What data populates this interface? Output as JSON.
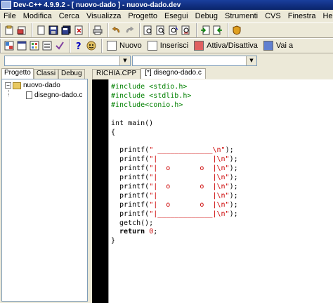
{
  "window": {
    "title": "Dev-C++ 4.9.9.2  - [ nuovo-dado ] - nuovo-dado.dev"
  },
  "menu": [
    "File",
    "Modifica",
    "Cerca",
    "Visualizza",
    "Progetto",
    "Esegui",
    "Debug",
    "Strumenti",
    "CVS",
    "Finestra",
    "Help"
  ],
  "toolbar2": {
    "new_label": "Nuovo",
    "insert_label": "Inserisci",
    "toggle_label": "Attiva/Disattiva",
    "goto_label": "Vai a"
  },
  "left_tabs": [
    "Progetto",
    "Classi",
    "Debug"
  ],
  "tree": {
    "project": "nuovo-dado",
    "file": "disegno-dado.c"
  },
  "editor_tabs": [
    "RICHIA.CPP",
    "[*] disegno-dado.c"
  ],
  "code": [
    {
      "t": "pre",
      "v": "#include <stdio.h>"
    },
    {
      "t": "pre",
      "v": "#include <stdlib.h>"
    },
    {
      "t": "pre",
      "v": "#include<conio.h>"
    },
    {
      "t": "plain",
      "v": ""
    },
    {
      "t": "plain",
      "v": "int main()"
    },
    {
      "t": "plain",
      "v": "{"
    },
    {
      "t": "plain",
      "v": ""
    },
    {
      "t": "printf",
      "a": "  printf(",
      "s": "\" _____________\\n\"",
      "b": ");"
    },
    {
      "t": "printf",
      "a": "  printf(",
      "s": "\"|             |\\n\"",
      "b": ");"
    },
    {
      "t": "printf",
      "a": "  printf(",
      "s": "\"|  o       o  |\\n\"",
      "b": ");"
    },
    {
      "t": "printf",
      "a": "  printf(",
      "s": "\"|             |\\n\"",
      "b": ");"
    },
    {
      "t": "printf",
      "a": "  printf(",
      "s": "\"|  o       o  |\\n\"",
      "b": ");"
    },
    {
      "t": "printf",
      "a": "  printf(",
      "s": "\"|             |\\n\"",
      "b": ");"
    },
    {
      "t": "printf",
      "a": "  printf(",
      "s": "\"|  o       o  |\\n\"",
      "b": ");"
    },
    {
      "t": "printf",
      "a": "  printf(",
      "s": "\"|_____________|\\n\"",
      "b": ");"
    },
    {
      "t": "plain",
      "v": "  getch();"
    },
    {
      "t": "ret",
      "a": "  return ",
      "n": "0",
      "b": ";"
    },
    {
      "t": "plain",
      "v": "}"
    }
  ]
}
